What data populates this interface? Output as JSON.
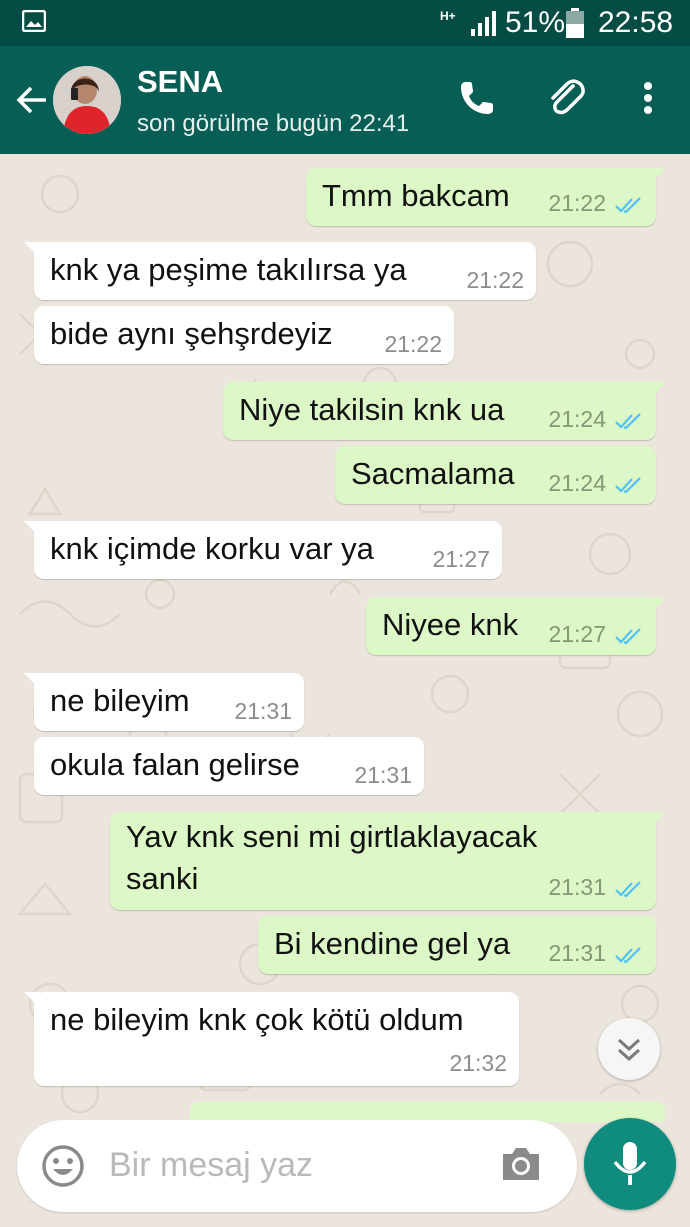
{
  "statusbar": {
    "network": "H+",
    "battery": "51%",
    "time": "22:58"
  },
  "header": {
    "contact_name": "SENA",
    "last_seen": "son görülme bugün 22:41"
  },
  "messages": [
    {
      "dir": "out",
      "text": "Tmm bakcam",
      "time": "21:22"
    },
    {
      "dir": "in",
      "text": "knk ya peşime takılırsa ya",
      "time": "21:22"
    },
    {
      "dir": "in",
      "text": "bide aynı şehşrdeyiz",
      "time": "21:22"
    },
    {
      "dir": "out",
      "text": "Niye takilsin knk ua",
      "time": "21:24"
    },
    {
      "dir": "out",
      "text": "Sacmalama",
      "time": "21:24"
    },
    {
      "dir": "in",
      "text": "knk içimde korku var ya",
      "time": "21:27"
    },
    {
      "dir": "out",
      "text": "Niyee knk",
      "time": "21:27"
    },
    {
      "dir": "in",
      "text": "ne bileyim",
      "time": "21:31"
    },
    {
      "dir": "in",
      "text": "okula falan gelirse",
      "time": "21:31"
    },
    {
      "dir": "out",
      "text": "Yav knk seni mi girtlaklayacak",
      "text2": "sanki",
      "time": "21:31"
    },
    {
      "dir": "out",
      "text": "Bi kendine gel ya",
      "time": "21:31"
    },
    {
      "dir": "in",
      "text": "ne bileyim knk çok kötü oldum",
      "time": "21:32"
    }
  ],
  "composer": {
    "placeholder": "Bir mesaj yaz"
  },
  "colors": {
    "statusbar": "#054d44",
    "appbar": "#075e54",
    "outgoing_bubble": "#dcf8c6",
    "incoming_bubble": "#ffffff",
    "read_ticks": "#4fc3f7",
    "mic_button": "#0f8c7e"
  },
  "icons": [
    "image-icon",
    "signal-icon",
    "battery-icon",
    "back-arrow-icon",
    "phone-icon",
    "paperclip-icon",
    "more-vert-icon",
    "read-ticks-icon",
    "chevron-down-icon",
    "emoji-icon",
    "camera-icon",
    "mic-icon"
  ]
}
